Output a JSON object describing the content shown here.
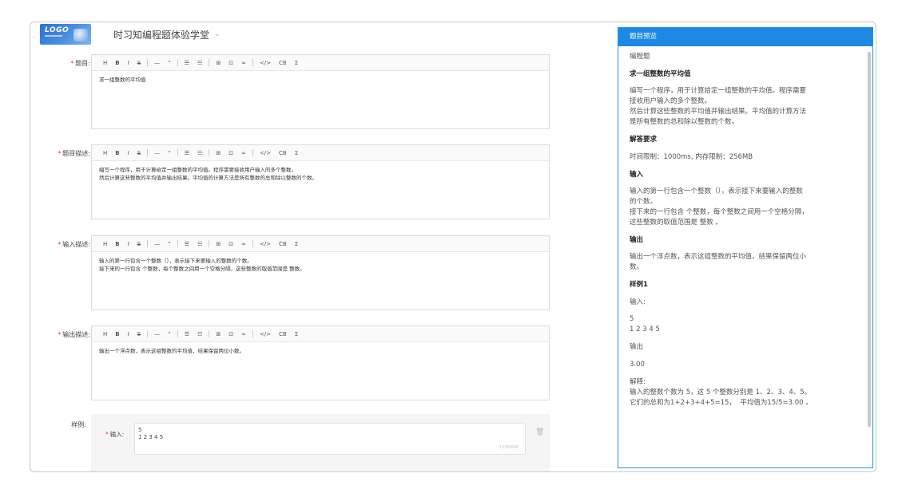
{
  "header": {
    "logo_text": "LOGO",
    "site_title": "时习知编程题体验学堂"
  },
  "toolbar": [
    "H",
    "B",
    "I",
    "S",
    "—",
    "“",
    "☰",
    "☷",
    "⊞",
    "⊡",
    "∞",
    "</>",
    "CB",
    "Σ"
  ],
  "fields": {
    "title": {
      "label": "题目:",
      "lines": [
        "求一组整数的平均值"
      ]
    },
    "description": {
      "label": "题目描述:",
      "lines": [
        "编写一个程序，用于计算给定一组整数的平均值。程序需要接收用户输入的多个整数。",
        "然后计算这些整数的平均值并输出结果。平均值的计算方法是所有整数的总和除以整数的个数。"
      ]
    },
    "input_desc": {
      "label": "输入描述:",
      "lines": [
        "输入的第一行包含一个整数（），表示接下来要输入的整数的个数。",
        "接下来的一行包含 个整数，每个整数之间用一个空格分隔，这些整数的取值范围是 整数。"
      ]
    },
    "output_desc": {
      "label": "输出描述:",
      "lines": [
        "输出一个浮点数，表示这组整数的平均值，结果保留两位小数。"
      ]
    }
  },
  "sample": {
    "label": "样例:",
    "input_label": "输入:",
    "input_lines": [
      "5",
      "1 2 3 4 5"
    ],
    "counter": "11/50000"
  },
  "preview": {
    "header": "题目预览",
    "type": "编程题",
    "title": "求一组整数的平均值",
    "desc": "编写一个程序，用于计算给定一组整数的平均值。程序需要\n接收用户输入的多个整数。\n然后计算这些整数的平均值并输出结果。平均值的计算方法\n是所有整数的总和除以整数的个数。",
    "req_heading": "解答要求",
    "limits": "时间限制：1000ms, 内存限制：256MB",
    "input_heading": "输入",
    "input_text": "输入的第一行包含一个整数（），表示接下来要输入的整数\n的个数。\n接下来的一行包含 个整数，每个整数之间用一个空格分隔，\n这些整数的取值范围是 整数 。",
    "output_heading": "输出",
    "output_text": "输出一个浮点数，表示这组整数的平均值，结果保留两位小\n数。",
    "sample_heading": "样例1",
    "sample_input_label": "输入:",
    "sample_input": "5\n1 2 3 4 5",
    "sample_output_label": "输出",
    "sample_output": "3.00",
    "explain_label": "解释:",
    "explain_text": "输入的整数个数为 5，这 5 个整数分别是 1、2、3、4、5。\n它们的总和为1+2+3+4+5=15，  平均值为15/5=3.00 。"
  }
}
